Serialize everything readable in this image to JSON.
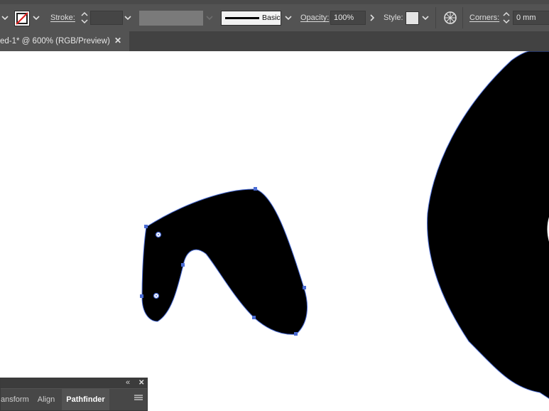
{
  "control_bar": {
    "stroke_label": "Stroke:",
    "stroke_weight_value": "",
    "brush_label": "Basic",
    "opacity_label": "Opacity:",
    "opacity_value": "100%",
    "style_label": "Style:",
    "corners_label": "Corners:",
    "corners_value": "0 mm"
  },
  "document_tab": {
    "title": "ed-1* @ 600% (RGB/Preview)",
    "close_glyph": "✕"
  },
  "panel": {
    "tabs": [
      {
        "label": "ansform",
        "active": false
      },
      {
        "label": "Align",
        "active": false
      },
      {
        "label": "Pathfinder",
        "active": true
      }
    ],
    "collapse_glyph": "«",
    "close_glyph": "✕"
  },
  "colors": {
    "ui_bg": "#535353",
    "canvas_bg": "#ffffff",
    "shape_fill": "#000000",
    "selection_blue": "#4a6cd4"
  }
}
